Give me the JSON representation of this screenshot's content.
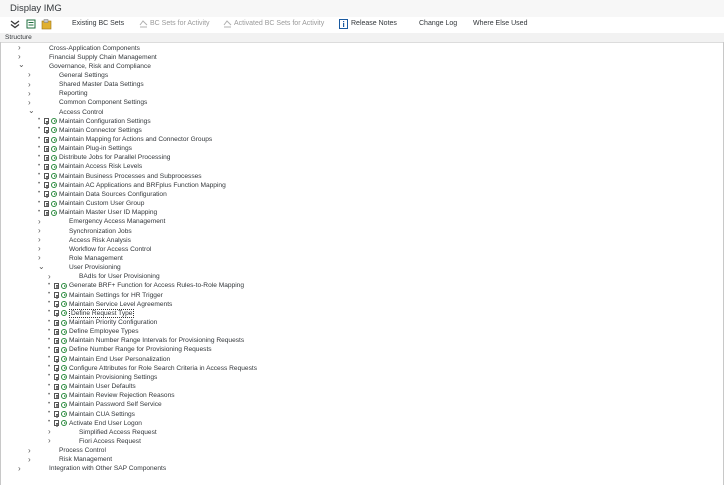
{
  "window": {
    "title": "Display IMG"
  },
  "toolbar": {
    "existing_bc_sets": "Existing BC Sets",
    "bc_sets_for_activity": "BC Sets for Activity",
    "activated_bc_sets": "Activated BC Sets for Activity",
    "release_notes": "Release Notes",
    "change_log": "Change Log",
    "where_else_used": "Where Else Used"
  },
  "structure": {
    "header": "Structure"
  },
  "tree": [
    {
      "label": "Cross-Application Components",
      "level": 1,
      "arrow": "right",
      "exec": false
    },
    {
      "label": "Financial Supply Chain Management",
      "level": 1,
      "arrow": "right",
      "exec": false
    },
    {
      "label": "Governance, Risk and Compliance",
      "level": 1,
      "arrow": "down",
      "exec": false
    },
    {
      "label": "General Settings",
      "level": 2,
      "arrow": "right",
      "exec": false
    },
    {
      "label": "Shared Master Data Settings",
      "level": 2,
      "arrow": "right",
      "exec": false
    },
    {
      "label": "Reporting",
      "level": 2,
      "arrow": "right",
      "exec": false
    },
    {
      "label": "Common Component Settings",
      "level": 2,
      "arrow": "right",
      "exec": false
    },
    {
      "label": "Access Control",
      "level": 2,
      "arrow": "down",
      "exec": false
    },
    {
      "label": "Maintain Configuration Settings",
      "level": 3,
      "exec": true
    },
    {
      "label": "Maintain Connector Settings",
      "level": 3,
      "exec": true
    },
    {
      "label": "Maintain Mapping for Actions and Connector Groups",
      "level": 3,
      "exec": true
    },
    {
      "label": "Maintain Plug-in Settings",
      "level": 3,
      "exec": true
    },
    {
      "label": "Distribute Jobs for Parallel Processing",
      "level": 3,
      "exec": true
    },
    {
      "label": "Maintain Access Risk Levels",
      "level": 3,
      "exec": true
    },
    {
      "label": "Maintain Business Processes and Subprocesses",
      "level": 3,
      "exec": true
    },
    {
      "label": "Maintain AC Applications and BRFplus Function Mapping",
      "level": 3,
      "exec": true
    },
    {
      "label": "Maintain Data Sources Configuration",
      "level": 3,
      "exec": true
    },
    {
      "label": "Maintain Custom User Group",
      "level": 3,
      "exec": true
    },
    {
      "label": "Maintain Master User ID Mapping",
      "level": 3,
      "exec": true
    },
    {
      "label": "Emergency Access Management",
      "level": 3,
      "arrow": "right",
      "exec": false
    },
    {
      "label": "Synchronization Jobs",
      "level": 3,
      "arrow": "right",
      "exec": false
    },
    {
      "label": "Access Risk Analysis",
      "level": 3,
      "arrow": "right",
      "exec": false
    },
    {
      "label": "Workflow for Access Control",
      "level": 3,
      "arrow": "right",
      "exec": false
    },
    {
      "label": "Role Management",
      "level": 3,
      "arrow": "right",
      "exec": false
    },
    {
      "label": "User Provisioning",
      "level": 3,
      "arrow": "down",
      "exec": false
    },
    {
      "label": "BAdIs for User Provisioning",
      "level": 4,
      "arrow": "right",
      "exec": false
    },
    {
      "label": "Generate BRF+ Function for Access Rules-to-Role Mapping",
      "level": 4,
      "exec": true
    },
    {
      "label": "Maintain Settings for HR Trigger",
      "level": 4,
      "exec": true
    },
    {
      "label": "Maintain Service Level Agreements",
      "level": 4,
      "exec": true
    },
    {
      "label": "Define Request   Type",
      "level": 4,
      "exec": true,
      "selected": true
    },
    {
      "label": "Maintain Priority Configuration",
      "level": 4,
      "exec": true
    },
    {
      "label": "Define Employee Types",
      "level": 4,
      "exec": true
    },
    {
      "label": "Maintain Number Range Intervals for Provisioning Requests",
      "level": 4,
      "exec": true
    },
    {
      "label": "Define Number Range for Provisioning Requests",
      "level": 4,
      "exec": true
    },
    {
      "label": "Maintain End User Personalization",
      "level": 4,
      "exec": true
    },
    {
      "label": "Configure Attributes for Role Search Criteria in Access Requests",
      "level": 4,
      "exec": true
    },
    {
      "label": "Maintain Provisioning Settings",
      "level": 4,
      "exec": true
    },
    {
      "label": "Maintain User Defaults",
      "level": 4,
      "exec": true
    },
    {
      "label": "Maintain Review Rejection Reasons",
      "level": 4,
      "exec": true
    },
    {
      "label": "Maintain Password Self Service",
      "level": 4,
      "exec": true
    },
    {
      "label": "Maintain CUA Settings",
      "level": 4,
      "exec": true
    },
    {
      "label": "Activate End User Logon",
      "level": 4,
      "exec": true
    },
    {
      "label": "Simplified Access Request",
      "level": 4,
      "arrow": "right",
      "exec": false
    },
    {
      "label": "Fiori Access Request",
      "level": 4,
      "arrow": "right",
      "exec": false
    },
    {
      "label": "Process Control",
      "level": 2,
      "arrow": "right",
      "exec": false
    },
    {
      "label": "Risk Management",
      "level": 2,
      "arrow": "right",
      "exec": false
    },
    {
      "label": "Integration with Other SAP Components",
      "level": 1,
      "arrow": "right",
      "exec": false
    }
  ]
}
